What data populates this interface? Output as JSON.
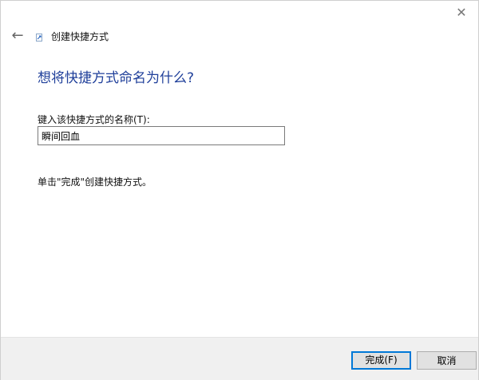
{
  "window": {
    "close_glyph": "✕",
    "back_glyph": "←",
    "title": "创建快捷方式"
  },
  "main": {
    "heading": "想将快捷方式命名为什么?",
    "field_label": "键入该快捷方式的名称(T):",
    "name_value": "瞬间回血",
    "hint": "单击\"完成\"创建快捷方式。"
  },
  "footer": {
    "finish_label": "完成(F)",
    "cancel_label": "取消"
  },
  "colors": {
    "heading": "#1f3f9a",
    "primary_border": "#0078d7"
  }
}
